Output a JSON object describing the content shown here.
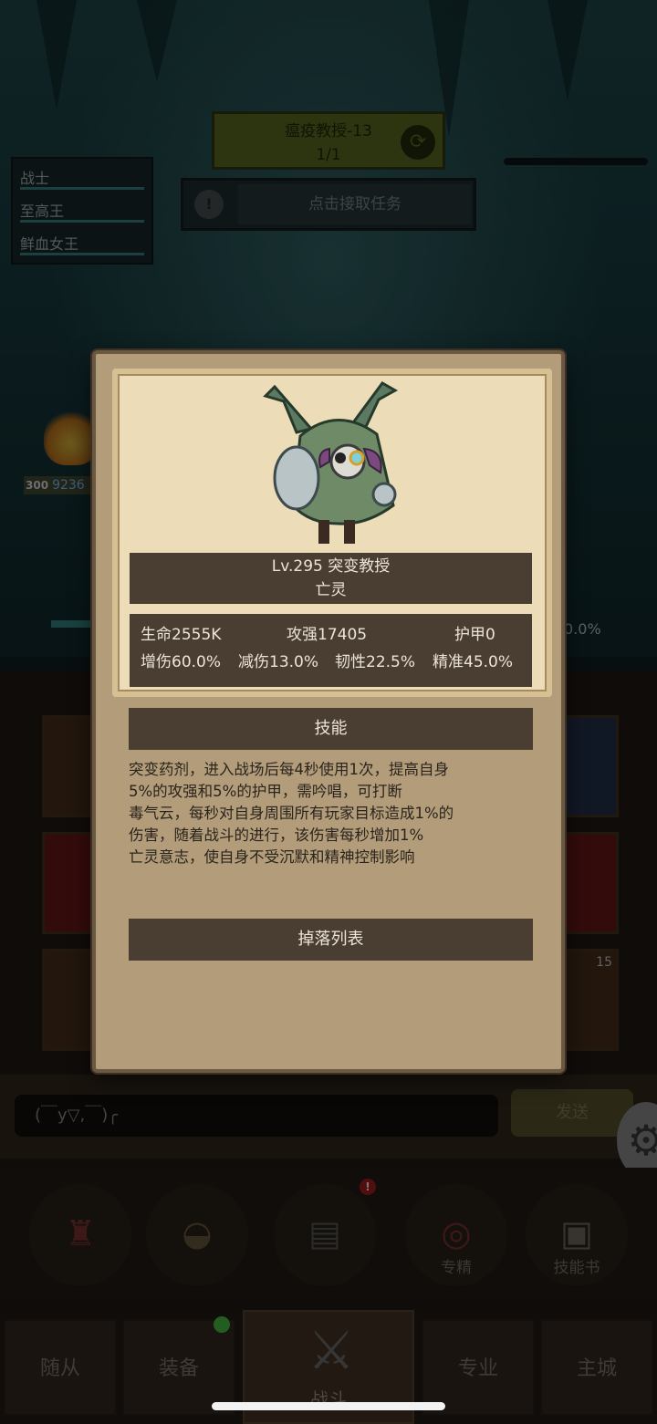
{
  "quest": {
    "title": "瘟疫教授-13",
    "progress": "1/1",
    "accept_label": "点击接取任务",
    "info_icon": "!",
    "refresh_icon": "refresh-icon"
  },
  "party": {
    "members": [
      "战士",
      "至高王",
      "鲜血女王"
    ]
  },
  "hero": {
    "level": "300",
    "hp_text": "9236"
  },
  "side_percent": "0.0%",
  "boss": {
    "level_name": "Lv.295 突变教授",
    "type": "亡灵",
    "stats": {
      "hp": "生命2555K",
      "attack": "攻强17405",
      "armor": "护甲0",
      "damage_up": "增伤60.0%",
      "damage_down": "减伤13.0%",
      "toughness": "韧性22.5%",
      "accuracy": "精准45.0%"
    },
    "skills_header": "技能",
    "skills_lines": [
      "突变药剂，进入战场后每4秒使用1次，提高自身",
      "5%的攻强和5%的护甲，需吟唱，可打断",
      "毒气云，每秒对自身周围所有玩家目标造成1%的",
      "伤害，随着战斗的进行，该伤害每秒增加1%",
      "亡灵意志，使自身不受沉默和精神控制影响"
    ],
    "drop_list_label": "掉落列表"
  },
  "chat": {
    "input_text": "(￣y▽,￣)╭",
    "send_label": "发送"
  },
  "actions": {
    "specialize_label": "专精",
    "skillbook_label": "技能书",
    "chest_badge": "!",
    "slot_badge": "15"
  },
  "nav": {
    "tabs": [
      "随从",
      "装备",
      "战斗",
      "专业",
      "主城"
    ]
  },
  "colors": {
    "popup_bg": "#b29c7a",
    "plate": "#4a3e33",
    "accent_quest": "#4f5a1c"
  }
}
